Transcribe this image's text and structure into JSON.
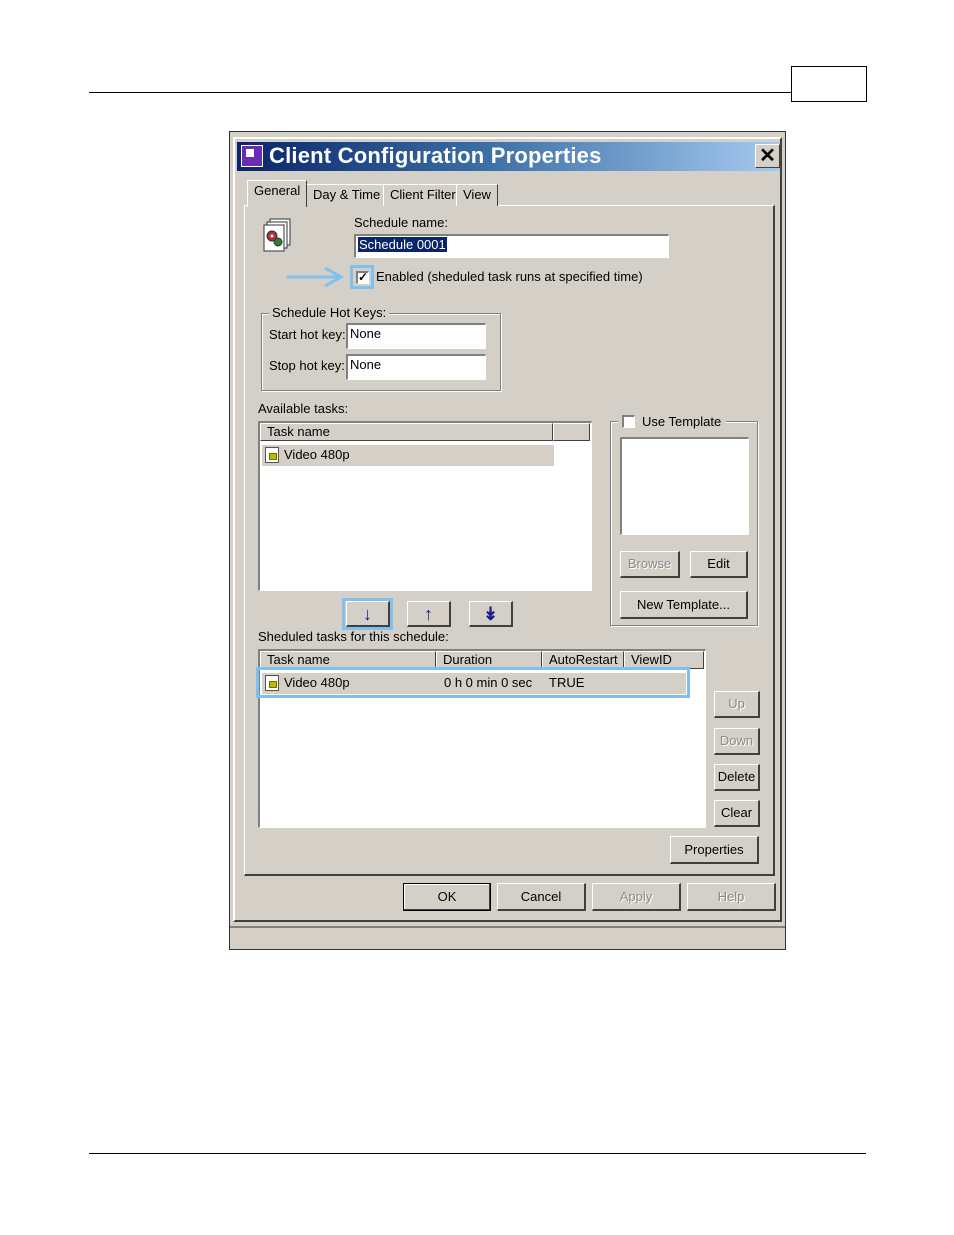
{
  "dialog": {
    "title": "Client Configuration Properties",
    "close_glyph": "✕"
  },
  "tabs": [
    "General",
    "Day & Time",
    "Client Filter",
    "View"
  ],
  "general": {
    "schedule_name_label": "Schedule name:",
    "schedule_name_value": "Schedule 0001",
    "enabled_label": "Enabled (sheduled task runs at specified time)",
    "enabled_checked": true,
    "hotkeys_group_label": "Schedule Hot Keys:",
    "start_hotkey_label": "Start hot key:",
    "start_hotkey_value": "None",
    "stop_hotkey_label": "Stop hot key:",
    "stop_hotkey_value": "None",
    "available_tasks_label": "Available tasks:",
    "available_columns": [
      "Task name"
    ],
    "available_tasks": [
      {
        "name": "Video 480p"
      }
    ],
    "use_template_label": "Use Template",
    "use_template_checked": false,
    "browse_label": "Browse",
    "edit_label": "Edit",
    "new_template_label": "New Template...",
    "arrow_down_glyph": "↓",
    "arrow_up_glyph": "↑",
    "arrow_double_down_glyph": "↡",
    "scheduled_tasks_label": "Sheduled tasks for this schedule:",
    "scheduled_columns": [
      "Task name",
      "Duration",
      "AutoRestart",
      "ViewID"
    ],
    "scheduled_tasks": [
      {
        "name": "Video 480p",
        "duration": "0 h 0 min 0 sec",
        "autorestart": "TRUE",
        "viewid": ""
      }
    ],
    "up_label": "Up",
    "down_label": "Down",
    "delete_label": "Delete",
    "clear_label": "Clear",
    "properties_label": "Properties"
  },
  "footer": {
    "ok_label": "OK",
    "cancel_label": "Cancel",
    "apply_label": "Apply",
    "help_label": "Help"
  },
  "colors": {
    "highlight": "#7fc0ef",
    "title_gradient_start": "#0a246a",
    "title_gradient_end": "#a6caf0",
    "dialog_face": "#d4d0c8"
  }
}
